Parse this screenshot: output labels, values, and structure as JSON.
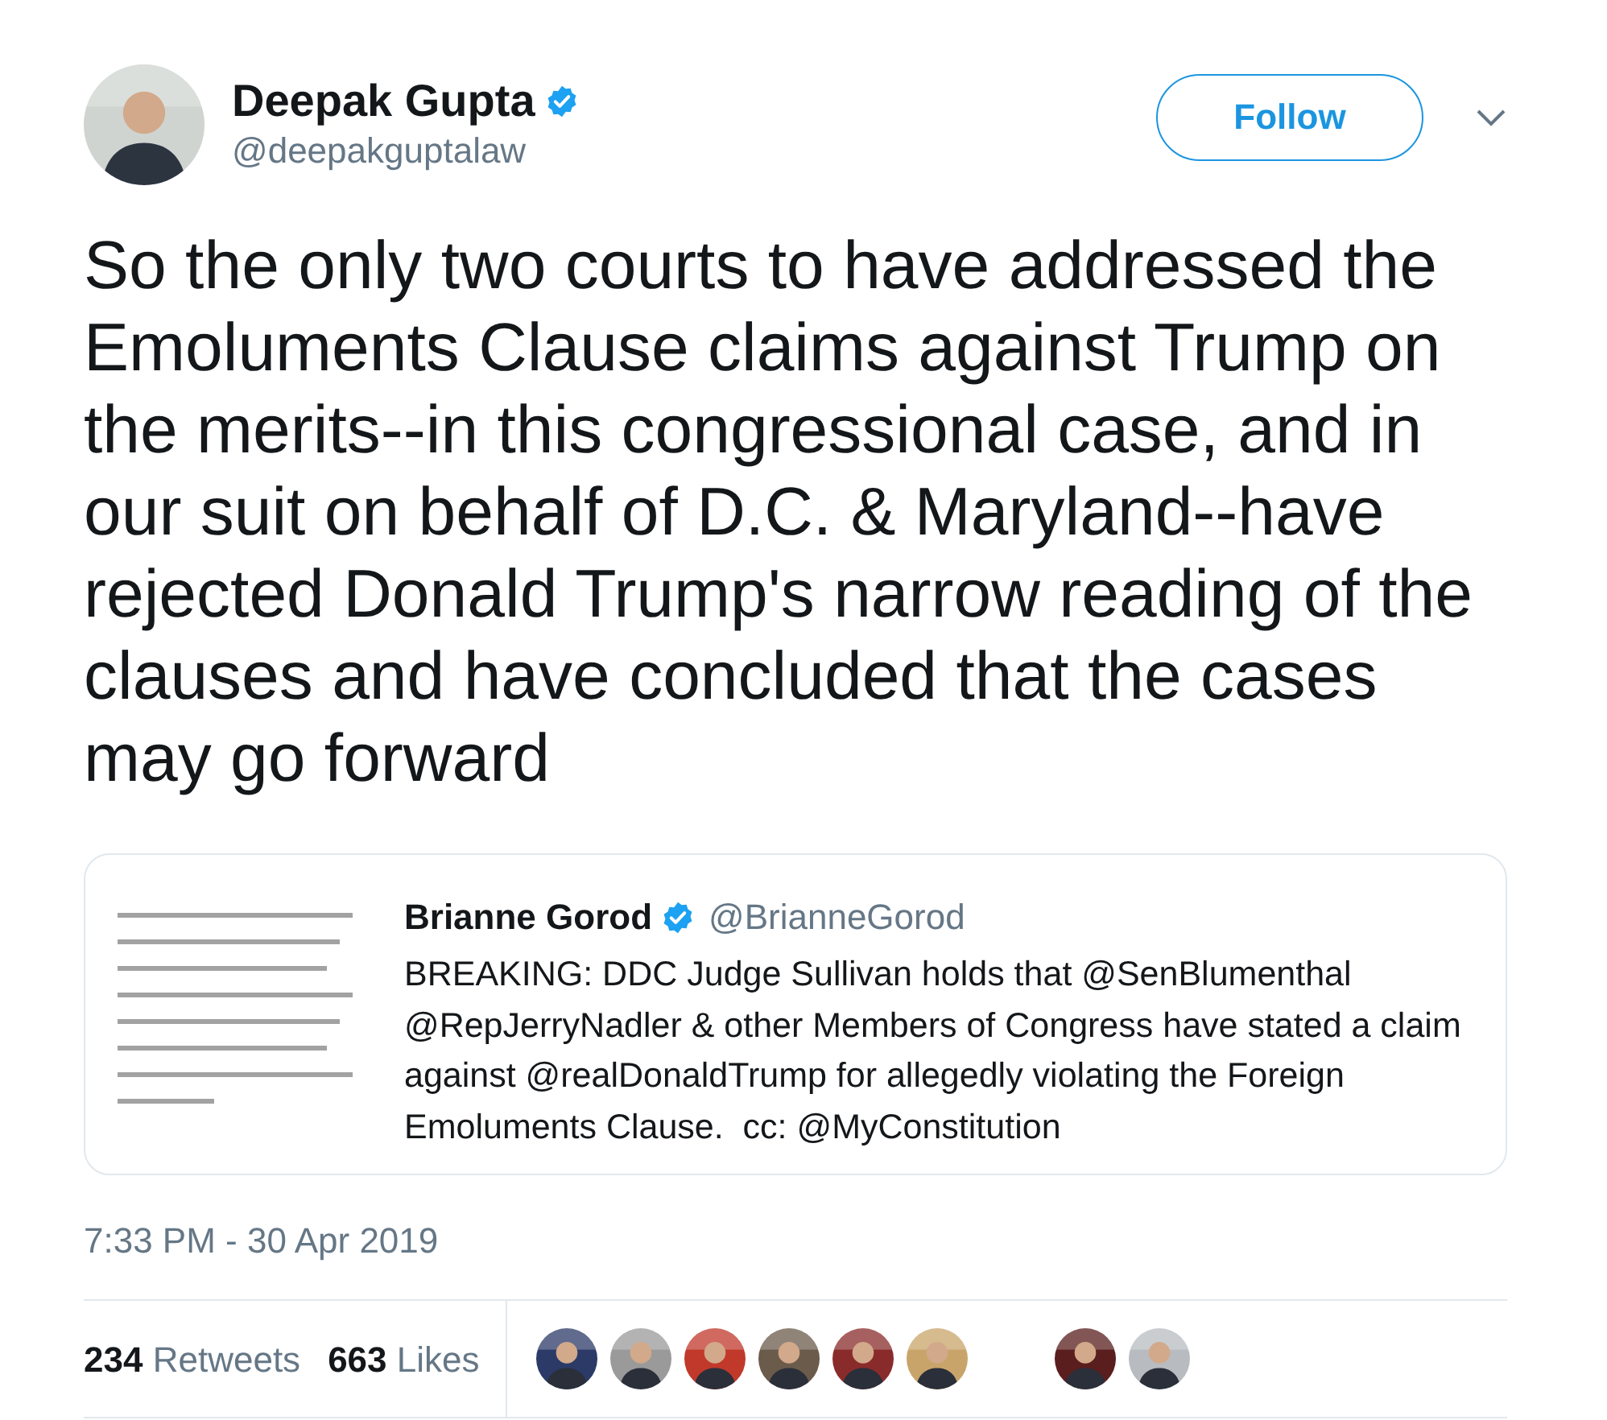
{
  "author": {
    "name": "Deepak Gupta",
    "verified": true,
    "handle": "@deepakguptalaw"
  },
  "follow_button": "Follow",
  "text": "So the only two courts to have addressed the Emoluments Clause claims against Trump on the merits--in this congressional case, and in our suit on behalf of D.C. & Maryland--have rejected Donald Trump's narrow reading of the clauses and have concluded that the cases may go forward",
  "quoted_tweet": {
    "thumbnail": {
      "kind": "picture"
    },
    "name": "Brianne Gorod",
    "verified": true,
    "handle": "@BrianneGorod",
    "text": "BREAKING: DDC Judge Sullivan holds that @SenBlumenthal @RepJerryNadler & other Members of Congress have stated a claim against @realDonaldTrump for allegedly violating the Foreign Emoluments Clause.  cc: @MyConstitution"
  },
  "timestamp": "7:33 PM - 30 Apr 2019",
  "stats": [
    {
      "count": "234",
      "label": "Retweets"
    },
    {
      "count": "663",
      "label": "Likes"
    }
  ],
  "liker_avatars": [
    {
      "kind": "picture"
    },
    {
      "kind": "picture"
    },
    {
      "kind": "picture"
    },
    {
      "kind": "picture"
    },
    {
      "kind": "picture"
    },
    {
      "kind": "picture"
    },
    {
      "kind": "blank"
    },
    {
      "kind": "picture"
    },
    {
      "kind": "picture"
    }
  ]
}
